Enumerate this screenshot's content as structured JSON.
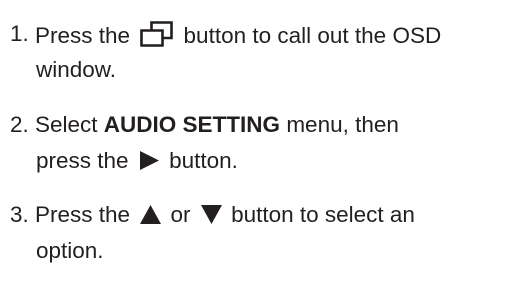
{
  "steps": [
    {
      "number": "1.",
      "line1_before": "Press the ",
      "icon": "osd-window-icon",
      "line1_after": " button to call out the OSD",
      "line2": "window."
    },
    {
      "number": "2.",
      "line1_before": "Select ",
      "line1_bold": "AUDIO SETTING",
      "line1_after": " menu, then",
      "line2_before": "press the ",
      "icon": "right-triangle-icon",
      "line2_after": " button."
    },
    {
      "number": "3.",
      "line1_before": "Press the ",
      "icon_up": "up-triangle-icon",
      "line1_mid": " or ",
      "icon_down": "down-triangle-icon",
      "line1_after": " button to select an",
      "line2": "option."
    }
  ]
}
